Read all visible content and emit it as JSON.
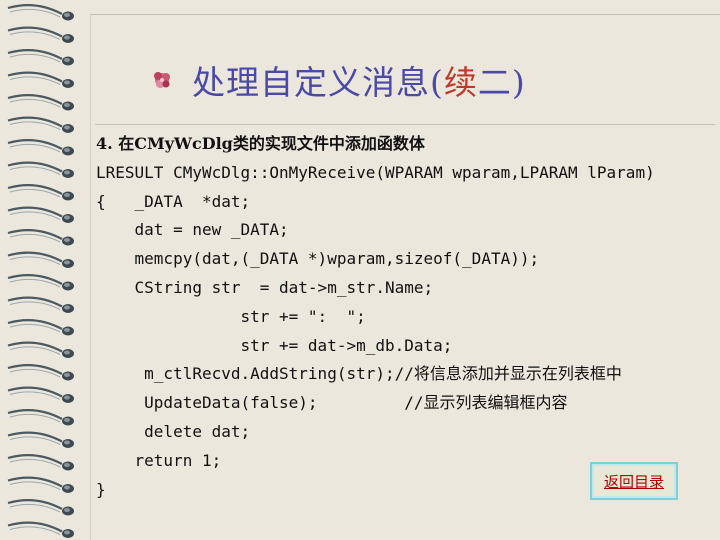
{
  "slide": {
    "title_main": "处理自定义消息(",
    "title_highlight": "续",
    "title_end": "二)",
    "icon": "bullet-flower-icon"
  },
  "code_lines": [
    "4. 在CMyWcDlg类的实现文件中添加函数体",
    "LRESULT CMyWcDlg::OnMyReceive(WPARAM wparam,LPARAM lParam)",
    "{   _DATA  *dat;",
    "    dat = new _DATA;",
    "    memcpy(dat,(_DATA *)wparam,sizeof(_DATA));",
    "    CString str  = dat->m_str.Name;",
    "               str += \":  \";",
    "               str += dat->m_db.Data;",
    "     m_ctlRecvd.AddString(str);//将信息添加并显示在列表框中",
    "     UpdateData(false);         //显示列表编辑框内容",
    "     delete dat;",
    "    return 1;",
    "}"
  ],
  "nav": {
    "return_label": "返回目录"
  },
  "colors": {
    "background": "#ece7dc",
    "title": "#4a4aa6",
    "accent": "#c0392b",
    "link": "#b10000"
  }
}
